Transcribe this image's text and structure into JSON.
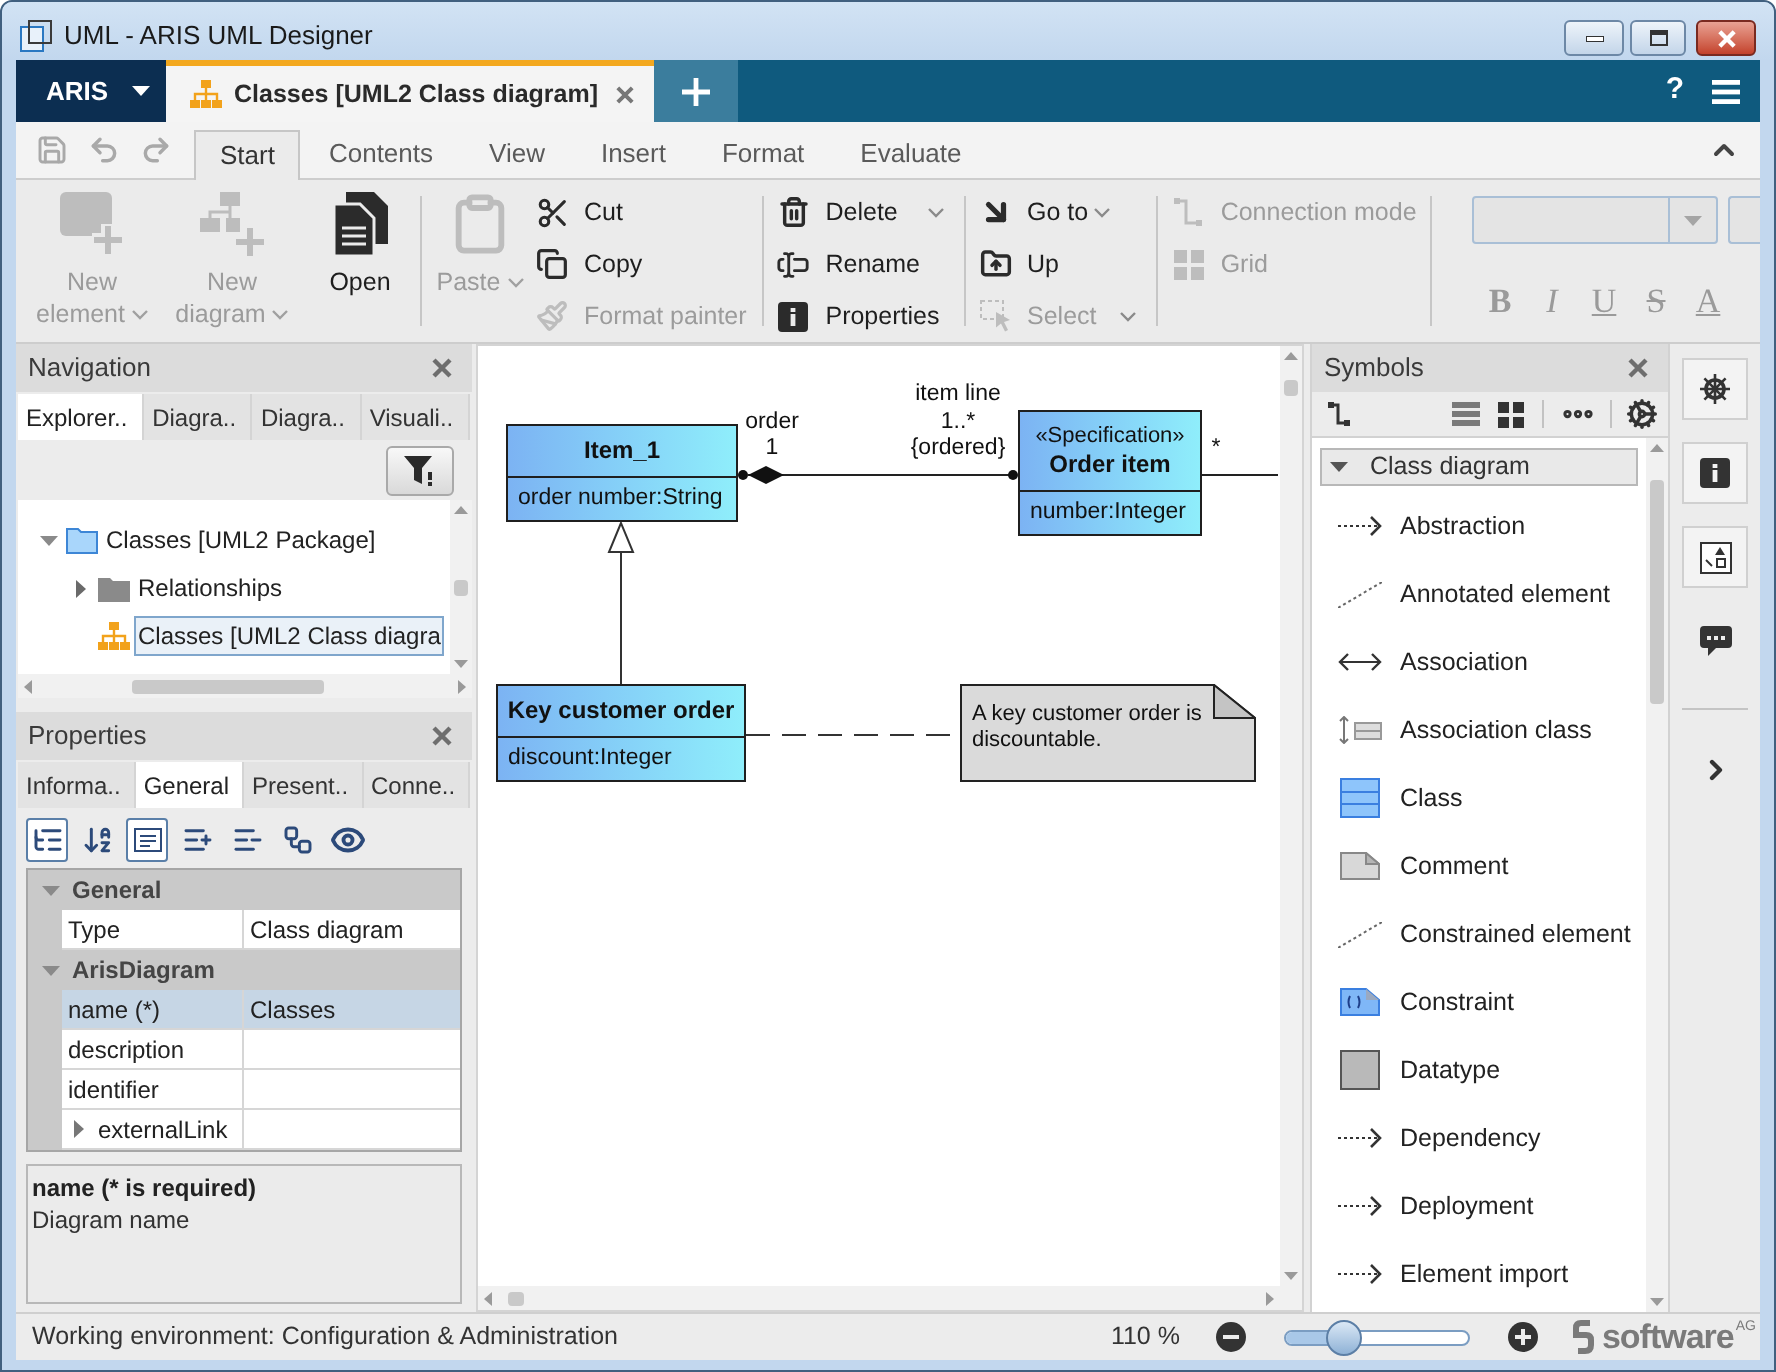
{
  "window": {
    "title": "UML - ARIS UML Designer"
  },
  "app_bar": {
    "menu": "ARIS",
    "tabs": [
      {
        "label": "Classes [UML2 Class diagram]",
        "selected": true
      }
    ],
    "help": "?"
  },
  "ribbon_tabs": [
    {
      "label": "Start",
      "selected": true
    },
    {
      "label": "Contents",
      "selected": false
    },
    {
      "label": "View",
      "selected": false
    },
    {
      "label": "Insert",
      "selected": false
    },
    {
      "label": "Format",
      "selected": false
    },
    {
      "label": "Evaluate",
      "selected": false
    }
  ],
  "ribbon": [
    {
      "kind": "large",
      "items": [
        {
          "label": "New element",
          "disabled": true,
          "dropdown": true
        },
        {
          "label": "New diagram",
          "disabled": true,
          "dropdown": true
        },
        {
          "label": "Open",
          "disabled": false,
          "dropdown": false
        }
      ]
    },
    {
      "kind": "large",
      "items": [
        {
          "label": "Paste",
          "disabled": true,
          "dropdown": true
        }
      ]
    },
    {
      "kind": "small",
      "items": [
        {
          "label": "Cut",
          "disabled": false,
          "dropdown": false
        },
        {
          "label": "Copy",
          "disabled": false,
          "dropdown": false
        },
        {
          "label": "Format painter",
          "disabled": true,
          "dropdown": false
        }
      ]
    },
    {
      "kind": "small",
      "items": [
        {
          "label": "Delete",
          "disabled": false,
          "dropdown": true
        },
        {
          "label": "Rename",
          "disabled": false,
          "dropdown": false
        },
        {
          "label": "Properties",
          "disabled": false,
          "dropdown": false
        }
      ]
    },
    {
      "kind": "small",
      "items": [
        {
          "label": "Go to",
          "disabled": false,
          "dropdown": true
        },
        {
          "label": "Up",
          "disabled": false,
          "dropdown": false
        },
        {
          "label": "Select",
          "disabled": true,
          "dropdown": true
        }
      ]
    },
    {
      "kind": "small",
      "items": [
        {
          "label": "Connection mode",
          "disabled": true,
          "dropdown": false
        },
        {
          "label": "Grid",
          "disabled": true,
          "dropdown": false
        }
      ]
    },
    {
      "kind": "format",
      "items": [
        {
          "label": "B",
          "disabled": true
        },
        {
          "label": "I",
          "disabled": true
        },
        {
          "label": "U",
          "disabled": true
        },
        {
          "label": "S",
          "disabled": true
        },
        {
          "label": "A",
          "disabled": true
        }
      ]
    }
  ],
  "navigation": {
    "title": "Navigation",
    "tabs": [
      {
        "label": "Explorer..",
        "selected": true
      },
      {
        "label": "Diagra..",
        "selected": false
      },
      {
        "label": "Diagra..",
        "selected": false
      },
      {
        "label": "Visuali..",
        "selected": false
      }
    ],
    "tree": [
      {
        "label": "Classes [UML2 Package]",
        "kind": "package",
        "expanded": true,
        "selected": false,
        "children": [
          {
            "label": "Relationships",
            "kind": "folder",
            "expanded": false,
            "selected": false
          },
          {
            "label": "Classes [UML2 Class diagra",
            "kind": "diagram",
            "selected": true
          }
        ]
      }
    ]
  },
  "properties": {
    "title": "Properties",
    "tabs": [
      {
        "label": "Informa..",
        "selected": false
      },
      {
        "label": "General",
        "selected": true
      },
      {
        "label": "Present..",
        "selected": false
      },
      {
        "label": "Conne..",
        "selected": false
      }
    ],
    "tools": [
      {
        "pressed": true
      },
      {
        "pressed": false
      },
      {
        "pressed": true
      },
      {
        "pressed": false
      },
      {
        "pressed": false
      },
      {
        "pressed": false
      },
      {
        "pressed": false
      }
    ],
    "groups": [
      {
        "title": "General",
        "expanded": true,
        "rows": [
          {
            "name": "Type",
            "value": "Class diagram",
            "selected": false
          }
        ]
      },
      {
        "title": "ArisDiagram",
        "expanded": true,
        "rows": [
          {
            "name": "name (*)",
            "value": "Classes",
            "selected": true
          },
          {
            "name": "description",
            "selected": false
          },
          {
            "name": "identifier",
            "selected": false
          },
          {
            "name": "externalLink",
            "selected": false,
            "expanded": false
          }
        ]
      }
    ],
    "help": {
      "title": "name (* is required)",
      "text": "Diagram name"
    }
  },
  "diagram": {
    "classes": [
      {
        "name": "Item_1",
        "attributes": [
          "order number:String"
        ]
      },
      {
        "stereotype": "«Specification»",
        "name": "Order item",
        "attributes": [
          "number:Integer"
        ]
      },
      {
        "name": "Key customer order",
        "attributes": [
          "discount:Integer"
        ]
      }
    ],
    "composition": {
      "source_role": "order",
      "source_multiplicity": "1",
      "target_role": "item line",
      "target_multiplicity": "1..*",
      "target_constraint": "{ordered}"
    },
    "association": {
      "multiplicity": "*"
    },
    "note": {
      "text": "A key customer order is discountable."
    }
  },
  "symbols": {
    "title": "Symbols",
    "group": {
      "label": "Class diagram",
      "expanded": true,
      "items": [
        {
          "label": "Abstraction",
          "kind": "arrow"
        },
        {
          "label": "Annotated element",
          "kind": "line"
        },
        {
          "label": "Association",
          "kind": "biarrow"
        },
        {
          "label": "Association class",
          "kind": "assoc"
        },
        {
          "label": "Class",
          "kind": "class"
        },
        {
          "label": "Comment",
          "kind": "note"
        },
        {
          "label": "Constrained element",
          "kind": "line"
        },
        {
          "label": "Constraint",
          "kind": "constraint"
        },
        {
          "label": "Datatype",
          "kind": "datatype"
        },
        {
          "label": "Dependency",
          "kind": "arrow"
        },
        {
          "label": "Deployment",
          "kind": "arrow"
        },
        {
          "label": "Element import",
          "kind": "arrow"
        }
      ]
    }
  },
  "status_bar": {
    "environment": "Working environment: Configuration & Administration",
    "zoom": "110 %",
    "zoom_slider": {
      "level": 0.28
    },
    "logo": {
      "name": "software",
      "suffix": "AG"
    }
  }
}
